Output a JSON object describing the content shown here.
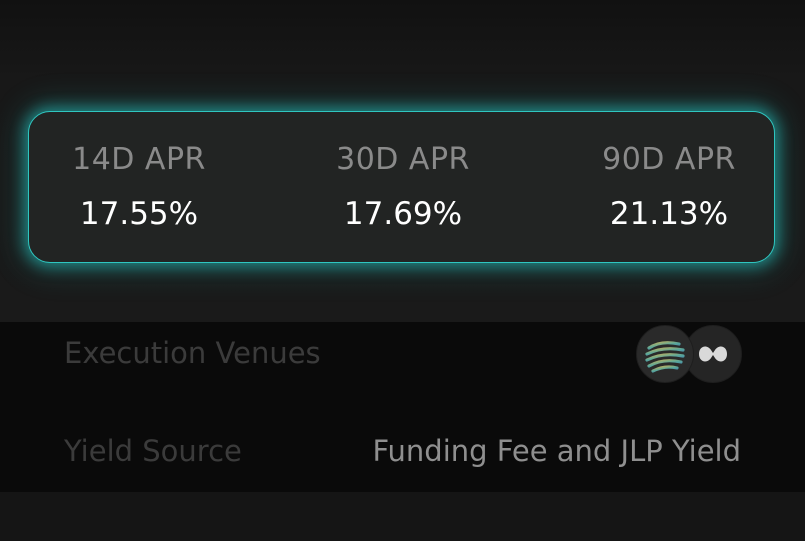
{
  "apr": [
    {
      "label": "14D APR",
      "value": "17.55%"
    },
    {
      "label": "30D APR",
      "value": "17.69%"
    },
    {
      "label": "90D APR",
      "value": "21.13%"
    }
  ],
  "execution_venues": {
    "label": "Execution Venues",
    "icons": [
      "drift-venue-icon",
      "hyperliquid-venue-icon"
    ]
  },
  "yield_source": {
    "label": "Yield Source",
    "value": "Funding Fee and JLP Yield"
  },
  "colors": {
    "accent": "#2fc6c0",
    "card_bg": "#222423",
    "label_gray": "#8a8a8a"
  }
}
